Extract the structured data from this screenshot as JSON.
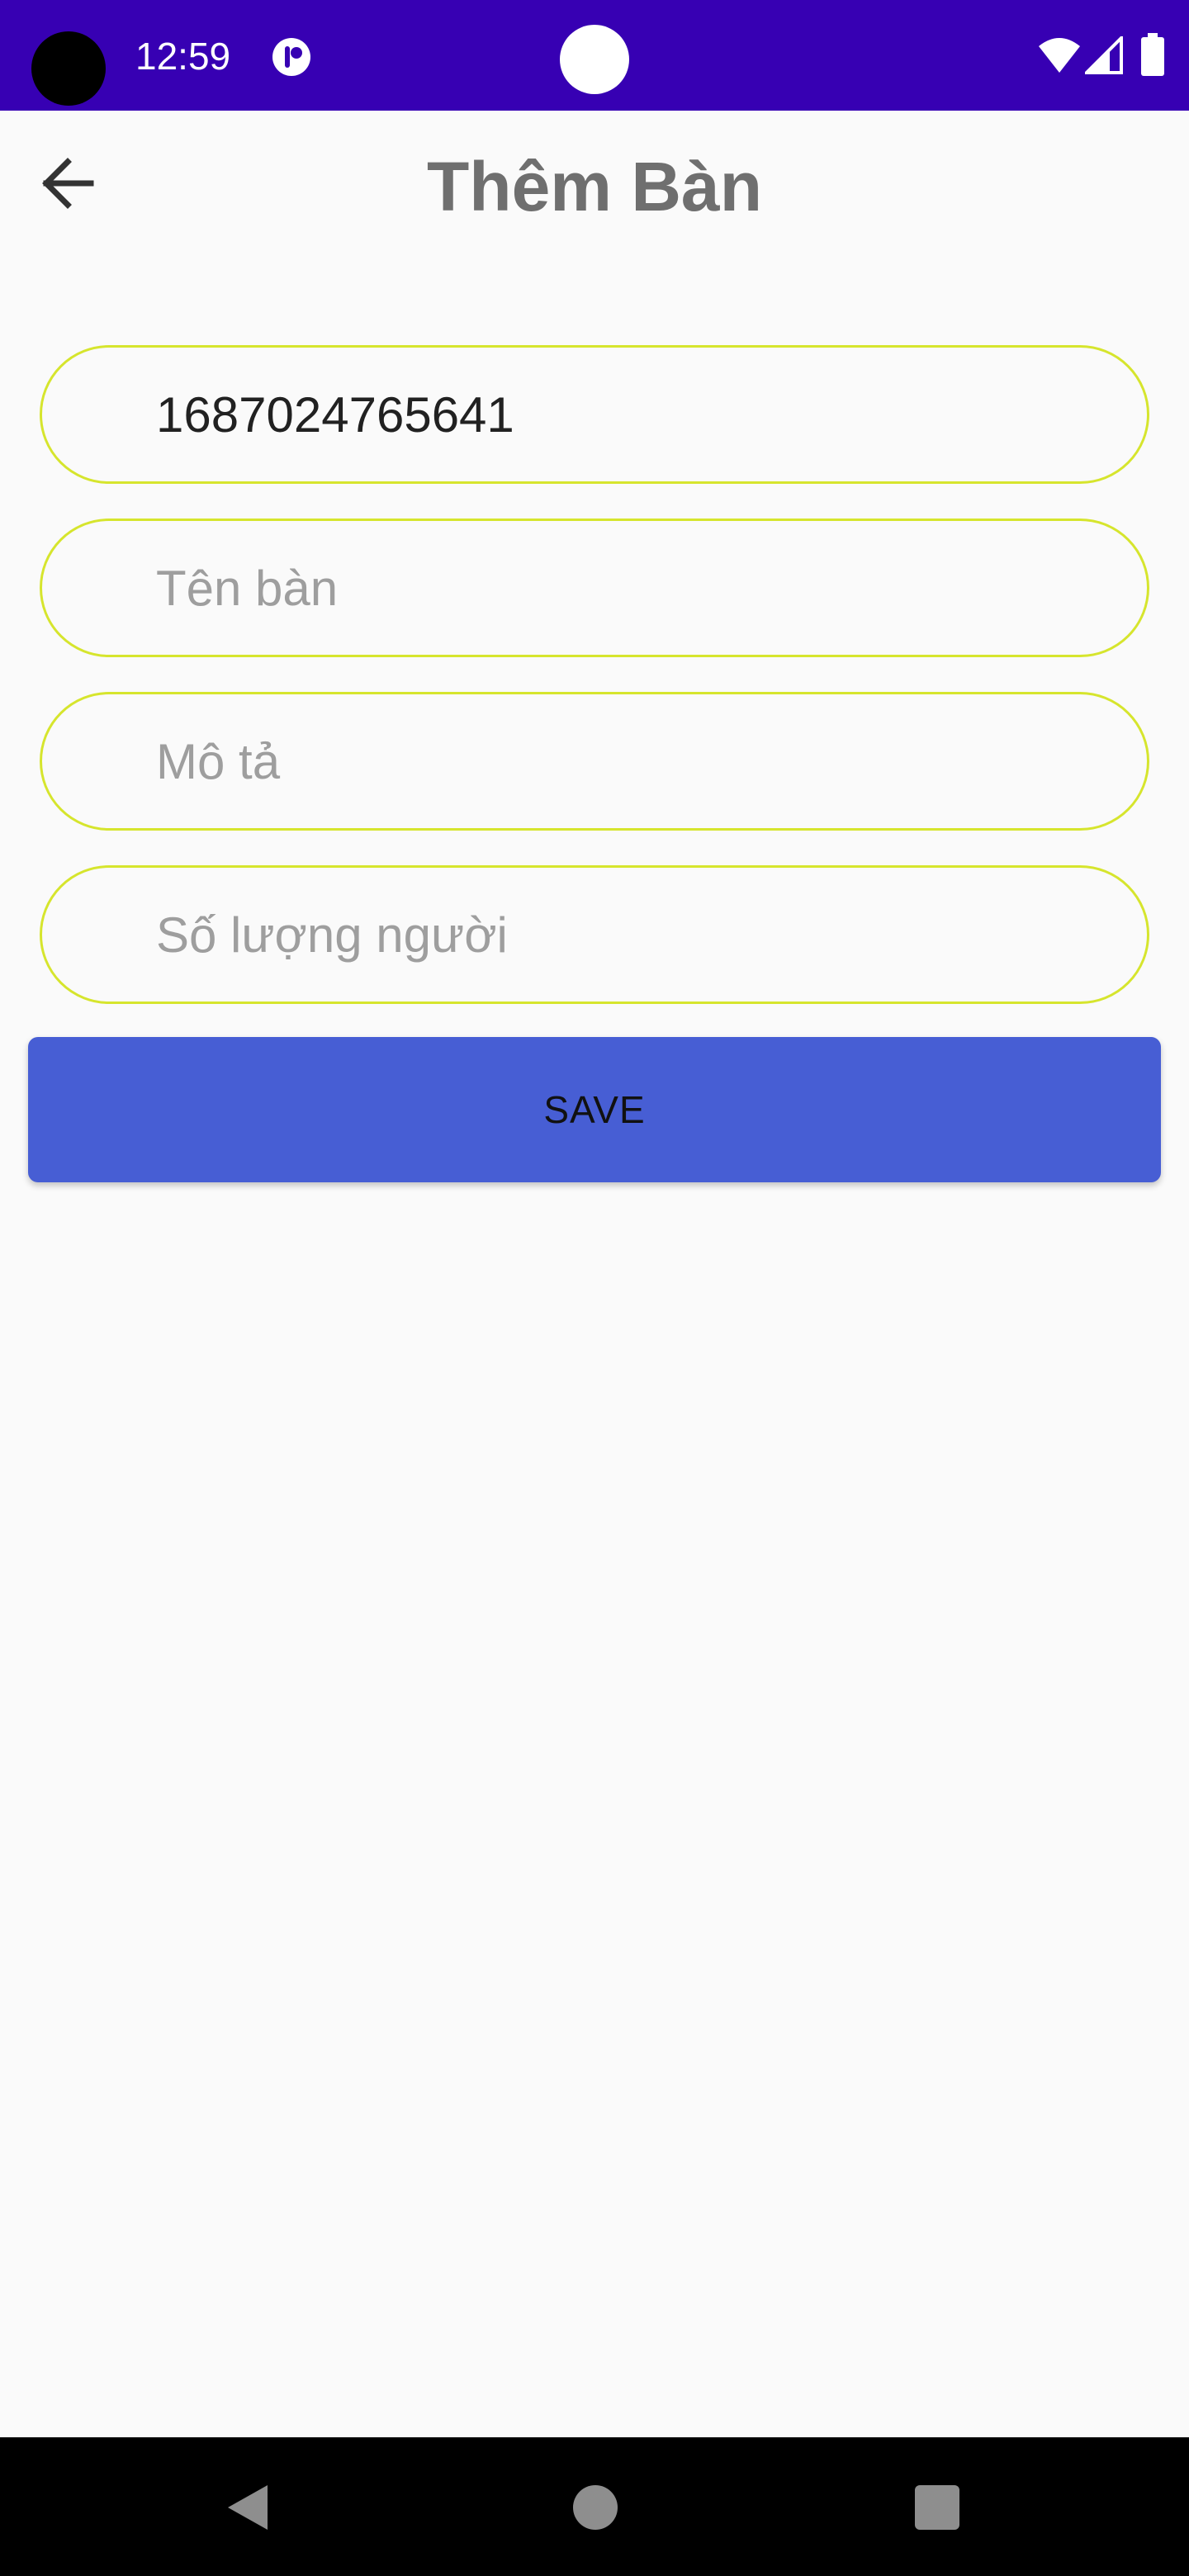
{
  "status_bar": {
    "time": "12:59",
    "background_color": "#3700b3",
    "icons": [
      "app-notification-icon",
      "wifi-icon",
      "cell-signal-icon",
      "battery-icon"
    ]
  },
  "app_bar": {
    "title": "Thêm Bàn",
    "back_icon": "arrow-left-icon"
  },
  "form": {
    "id_field": {
      "value": "1687024765641",
      "placeholder": ""
    },
    "name_field": {
      "value": "",
      "placeholder": "Tên bàn"
    },
    "description_field": {
      "value": "",
      "placeholder": "Mô tả"
    },
    "capacity_field": {
      "value": "",
      "placeholder": "Số lượng người"
    },
    "field_border_color": "#d6e52d"
  },
  "save_button": {
    "label": "SAVE",
    "background_color": "#475ed4"
  },
  "nav_bar": {
    "icons": [
      "nav-back-icon",
      "nav-home-icon",
      "nav-recents-icon"
    ]
  }
}
